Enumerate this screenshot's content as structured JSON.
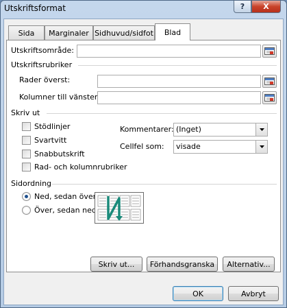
{
  "window": {
    "title": "Utskriftsformat",
    "help_label": "?",
    "close_label": "X"
  },
  "tabs": [
    {
      "label": "Sida",
      "active": false
    },
    {
      "label": "Marginaler",
      "active": false
    },
    {
      "label": "Sidhuvud/sidfot",
      "active": false
    },
    {
      "label": "Blad",
      "active": true
    }
  ],
  "print_area": {
    "label": "Utskriftsområde:",
    "value": ""
  },
  "print_titles": {
    "section_label": "Utskriftsrubriker",
    "rows_label": "Rader överst:",
    "rows_value": "",
    "cols_label": "Kolumner till vänster:",
    "cols_value": ""
  },
  "print": {
    "section_label": "Skriv ut",
    "checkboxes": [
      {
        "label": "Stödlinjer",
        "checked": false
      },
      {
        "label": "Svartvitt",
        "checked": false
      },
      {
        "label": "Snabbutskrift",
        "checked": false
      },
      {
        "label": "Rad- och kolumnrubriker",
        "checked": false
      }
    ],
    "comments_label": "Kommentarer:",
    "comments_value": "(Inget)",
    "errors_label": "Cellfel som:",
    "errors_value": "visade"
  },
  "page_order": {
    "section_label": "Sidordning",
    "options": [
      {
        "label": "Ned, sedan över",
        "selected": true
      },
      {
        "label": "Över, sedan ned",
        "selected": false
      }
    ]
  },
  "panel_buttons": {
    "print": "Skriv ut...",
    "preview": "Förhandsgranska",
    "options": "Alternativ..."
  },
  "dialog_buttons": {
    "ok": "OK",
    "cancel": "Avbryt"
  },
  "colors": {
    "accent": "#1d4f8d",
    "preview_arrow": "#1a8a7a"
  }
}
